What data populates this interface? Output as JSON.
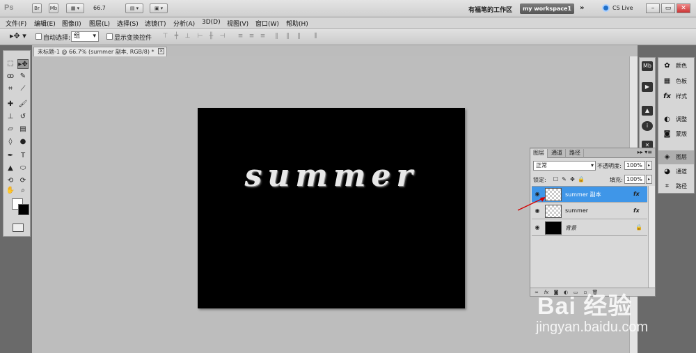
{
  "app": {
    "logo": "Ps",
    "bridge_label": "Br",
    "minibridge_label": "Mb",
    "zoom": "66.7",
    "workspace_name": "有福笔的工作区",
    "workspace_button": "my workspace1",
    "more": "»",
    "cs_live": "CS Live",
    "win_min": "–",
    "win_max": "▭",
    "win_close": "✕"
  },
  "menu": [
    "文件(F)",
    "编辑(E)",
    "图像(I)",
    "图层(L)",
    "选择(S)",
    "滤镜(T)",
    "分析(A)",
    "3D(D)",
    "视图(V)",
    "窗口(W)",
    "帮助(H)"
  ],
  "options": {
    "auto_select_label": "自动选择:",
    "auto_select_value": "组",
    "show_transform_label": "显示变换控件"
  },
  "document": {
    "tab_title": "未标题-1 @ 66.7% (summer 副本, RGB/8) *",
    "canvas_text": "summer"
  },
  "panels_collapsed": [
    {
      "icon": "palette-icon",
      "label": "颜色"
    },
    {
      "icon": "swatches-icon",
      "label": "色板"
    },
    {
      "icon": "fx-icon",
      "label": "样式"
    },
    {
      "icon": "adjust-icon",
      "label": "调整"
    },
    {
      "icon": "mask-icon",
      "label": "蒙版"
    },
    {
      "icon": "layers-icon",
      "label": "图层"
    },
    {
      "icon": "channels-icon",
      "label": "通道"
    },
    {
      "icon": "paths-icon",
      "label": "路径"
    }
  ],
  "layers_panel": {
    "tabs": [
      "图层",
      "通道",
      "路径"
    ],
    "blend_mode": "正常",
    "opacity_label": "不透明度:",
    "opacity_value": "100%",
    "lock_label": "锁定:",
    "fill_label": "填充:",
    "fill_value": "100%",
    "layers": [
      {
        "name": "summer 副本",
        "selected": true,
        "fx": "fx",
        "thumb": "transparent"
      },
      {
        "name": "summer",
        "selected": false,
        "fx": "fx",
        "thumb": "transparent"
      },
      {
        "name": "背景",
        "selected": false,
        "fx": "",
        "thumb": "black",
        "locked": true
      }
    ]
  },
  "watermark": {
    "brand": "Bai 经验",
    "url": "jingyan.baidu.com"
  }
}
